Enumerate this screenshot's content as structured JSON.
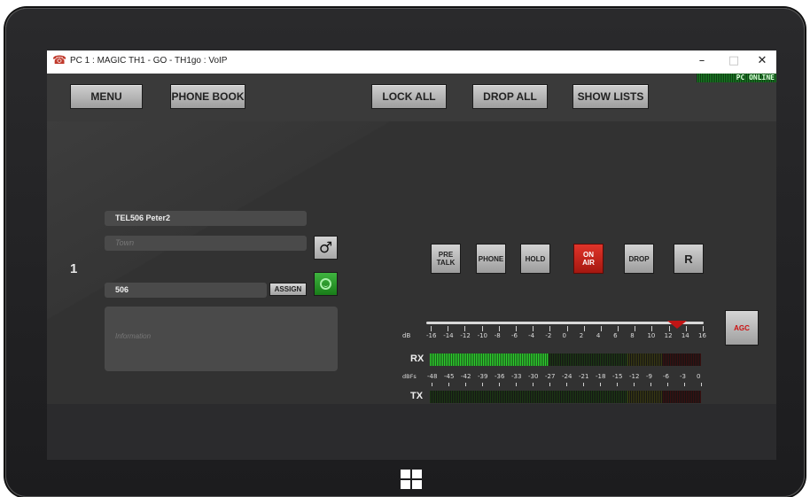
{
  "window": {
    "title": "PC 1 : MAGIC TH1 - GO - TH1go : VoIP",
    "minimize": "–",
    "maximize": "□",
    "close": "✕"
  },
  "toolbar": {
    "menu": "MENU",
    "phone_book": "PHONE BOOK",
    "lock_all": "LOCK ALL",
    "drop_all": "DROP ALL",
    "show_lists": "SHOW LISTS",
    "status": "PC ONLINE"
  },
  "line": {
    "number": "1",
    "name": "TEL506 Peter2",
    "town_placeholder": "Town",
    "phone": "506",
    "assign": "ASSIGN",
    "info_placeholder": "Information",
    "gender_symbol": "♂"
  },
  "controls": {
    "pre_talk": [
      "PRE",
      "TALK"
    ],
    "phone": "PHONE",
    "hold": "HOLD",
    "on_air": [
      "ON",
      "AIR"
    ],
    "drop": "DROP",
    "r": "R",
    "agc": "AGC"
  },
  "gain": {
    "label": "dB",
    "ticks": [
      "-16",
      "-14",
      "-12",
      "-10",
      "-8",
      "-6",
      "-4",
      "-2",
      "0",
      "2",
      "4",
      "6",
      "8",
      "10",
      "12",
      "14",
      "16"
    ],
    "value_db": 13
  },
  "meters": {
    "rx_label": "RX",
    "tx_label": "TX",
    "scale_label": "dBFs",
    "ticks": [
      "-48",
      "-45",
      "-42",
      "-39",
      "-36",
      "-33",
      "-30",
      "-27",
      "-24",
      "-21",
      "-18",
      "-15",
      "-12",
      "-9",
      "-6",
      "-3",
      "0"
    ],
    "rx_level_dbfs": -27,
    "tx_level_dbfs": -48
  },
  "colors": {
    "on_air": "#c8221a",
    "meter_green": "#2fd02f",
    "meter_yellow": "#8d8d1a",
    "meter_red": "#6a1212",
    "status_green": "#1d7a25"
  },
  "icons": {
    "app": "phone-app-icon",
    "gender": "male-symbol-icon",
    "caller": "smiley-icon",
    "taskbar": "windows-logo-icon"
  }
}
